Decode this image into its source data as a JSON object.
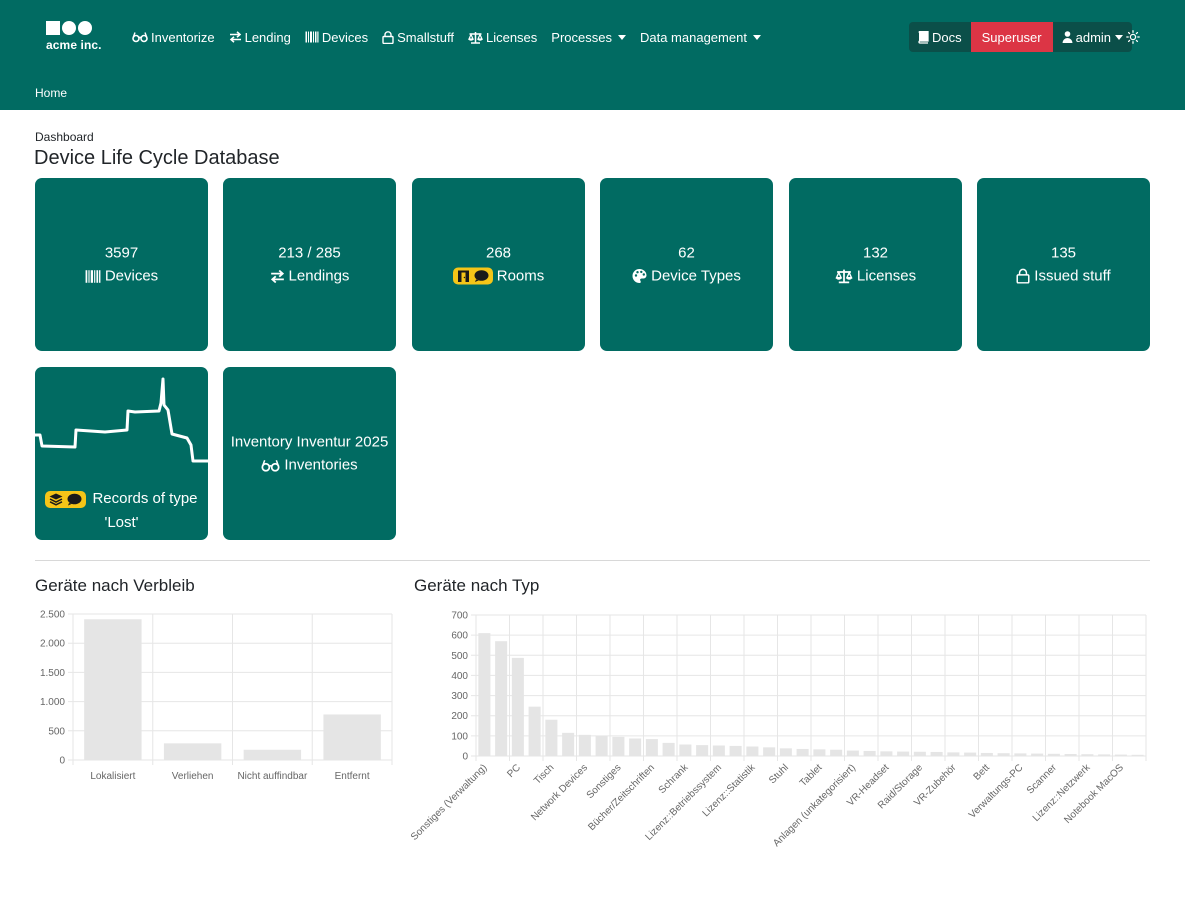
{
  "brand": {
    "logo_text": "acme inc."
  },
  "nav": {
    "items": [
      {
        "label": "Inventorize",
        "icon": "glasses-icon"
      },
      {
        "label": "Lending",
        "icon": "arrows-exchange-icon"
      },
      {
        "label": "Devices",
        "icon": "barcode-icon"
      },
      {
        "label": "Smallstuff",
        "icon": "lock-icon"
      },
      {
        "label": "Licenses",
        "icon": "scale-icon"
      },
      {
        "label": "Processes",
        "icon": "",
        "dropdown": true
      },
      {
        "label": "Data management",
        "icon": "",
        "dropdown": true
      }
    ],
    "docs_label": "Docs",
    "superuser_label": "Superuser",
    "admin_label": "admin",
    "theme_icon": "sun-icon"
  },
  "breadcrumb": {
    "home": "Home"
  },
  "header": {
    "label": "Dashboard",
    "title": "Device Life Cycle Database"
  },
  "cards": [
    {
      "count": "3597",
      "label": "Devices",
      "icon": "barcode-icon"
    },
    {
      "count": "213 / 285",
      "label": "Lendings",
      "icon": "arrows-exchange-icon"
    },
    {
      "count": "268",
      "label": "Rooms",
      "icon": "door-comment-badge"
    },
    {
      "count": "62",
      "label": "Device Types",
      "icon": "palette-icon"
    },
    {
      "count": "132",
      "label": "Licenses",
      "icon": "scale-icon"
    },
    {
      "count": "135",
      "label": "Issued stuff",
      "icon": "lock-icon"
    }
  ],
  "lost_card": {
    "label_line1": "Records of type",
    "label_line2": "'Lost'",
    "icon": "layers-comment-badge"
  },
  "inventory_card": {
    "line1": "Inventory Inventur 2025",
    "line2": "Inventories",
    "icon": "glasses-icon"
  },
  "chart_data": [
    {
      "type": "bar",
      "title": "Geräte nach Verbleib",
      "categories": [
        "Lokalisiert",
        "Verliehen",
        "Nicht auffindbar",
        "Entfernt"
      ],
      "values": [
        2410,
        285,
        175,
        780
      ],
      "yticks": [
        "0",
        "500",
        "1.000",
        "1.500",
        "2.000",
        "2.500"
      ],
      "ylim": [
        0,
        2500
      ],
      "grid": true,
      "color": "#e5e5e5"
    },
    {
      "type": "bar",
      "title": "Geräte nach Typ",
      "categories": [
        "Sonstiges (Verwaltung)",
        "",
        "PC",
        "",
        "Tisch",
        "",
        "Network Devices",
        "",
        "Sonstiges",
        "",
        "Bücher/Zeitschriften",
        "",
        "Schrank",
        "",
        "Lizenz::Betriebssystem",
        "",
        "Lizenz::Statistik",
        "",
        "Stuhl",
        "",
        "Tablet",
        "",
        "Anlagen (unkategorisiert)",
        "",
        "VR-Headset",
        "",
        "Raid/Storage",
        "",
        "VR-Zubehör",
        "",
        "Bett",
        "",
        "Verwaltungs-PC",
        "",
        "Scanner",
        "",
        "Lizenz::Netzwerk",
        "",
        "Notebook MacOS",
        ""
      ],
      "values": [
        610,
        570,
        487,
        245,
        180,
        115,
        105,
        100,
        95,
        87,
        84,
        65,
        57,
        54,
        52,
        50,
        47,
        43,
        38,
        35,
        33,
        31,
        27,
        25,
        23,
        22,
        21,
        20,
        18,
        17,
        15,
        14,
        13,
        12,
        11,
        10,
        9,
        8,
        7,
        6
      ],
      "yticks": [
        "0",
        "100",
        "200",
        "300",
        "400",
        "500",
        "600",
        "700"
      ],
      "ylim": [
        0,
        700
      ],
      "grid": true,
      "color": "#e5e5e5"
    }
  ]
}
